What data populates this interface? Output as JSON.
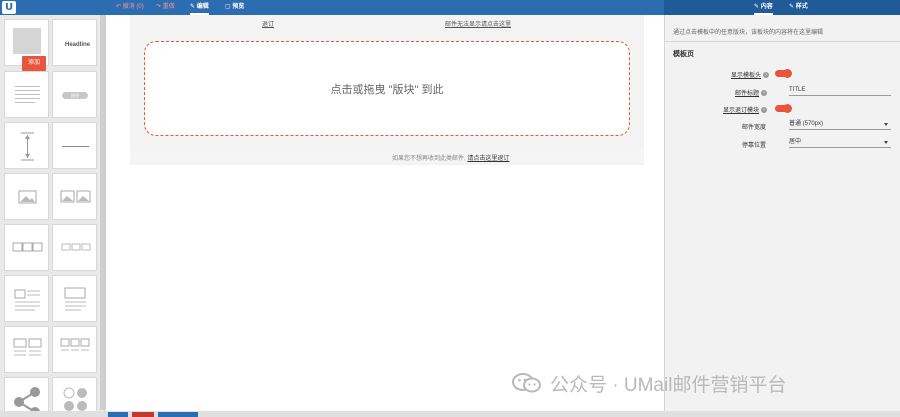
{
  "app": {
    "logo_letter": "U"
  },
  "toolbar": {
    "undo": "撤消 (0)",
    "redo": "重做",
    "edit": "编辑",
    "preview": "预览",
    "content_tab": "内容",
    "style_tab": "样式"
  },
  "blocks": {
    "add_label": "添加",
    "headline": "Headline",
    "button_text": "按钮"
  },
  "canvas": {
    "unsubscribe_top": "退订",
    "webview_top": "邮件无法显示请点击这里",
    "dropzone": "点击或拖曳 \"版块\" 到此",
    "footer_text": "如果您不想再收到此类邮件,",
    "footer_link": "请点击这里退订"
  },
  "right_panel": {
    "description": "通过点击模板中的任意版块，该板块的内容将在这里编辑",
    "section_title": "模板页",
    "show_header_label": "显示模板头",
    "mail_title_label": "邮件标题",
    "mail_title_value": "TITLE",
    "show_unsub_label": "显示退订模块",
    "width_label": "邮件宽度",
    "width_value": "普通 (570px)",
    "align_label": "停靠位置",
    "align_value": "居中"
  },
  "watermark": {
    "text": "公众号 · UMail邮件营销平台"
  },
  "colors": {
    "accent": "#e8553d",
    "topbar": "#2c6cb0"
  }
}
